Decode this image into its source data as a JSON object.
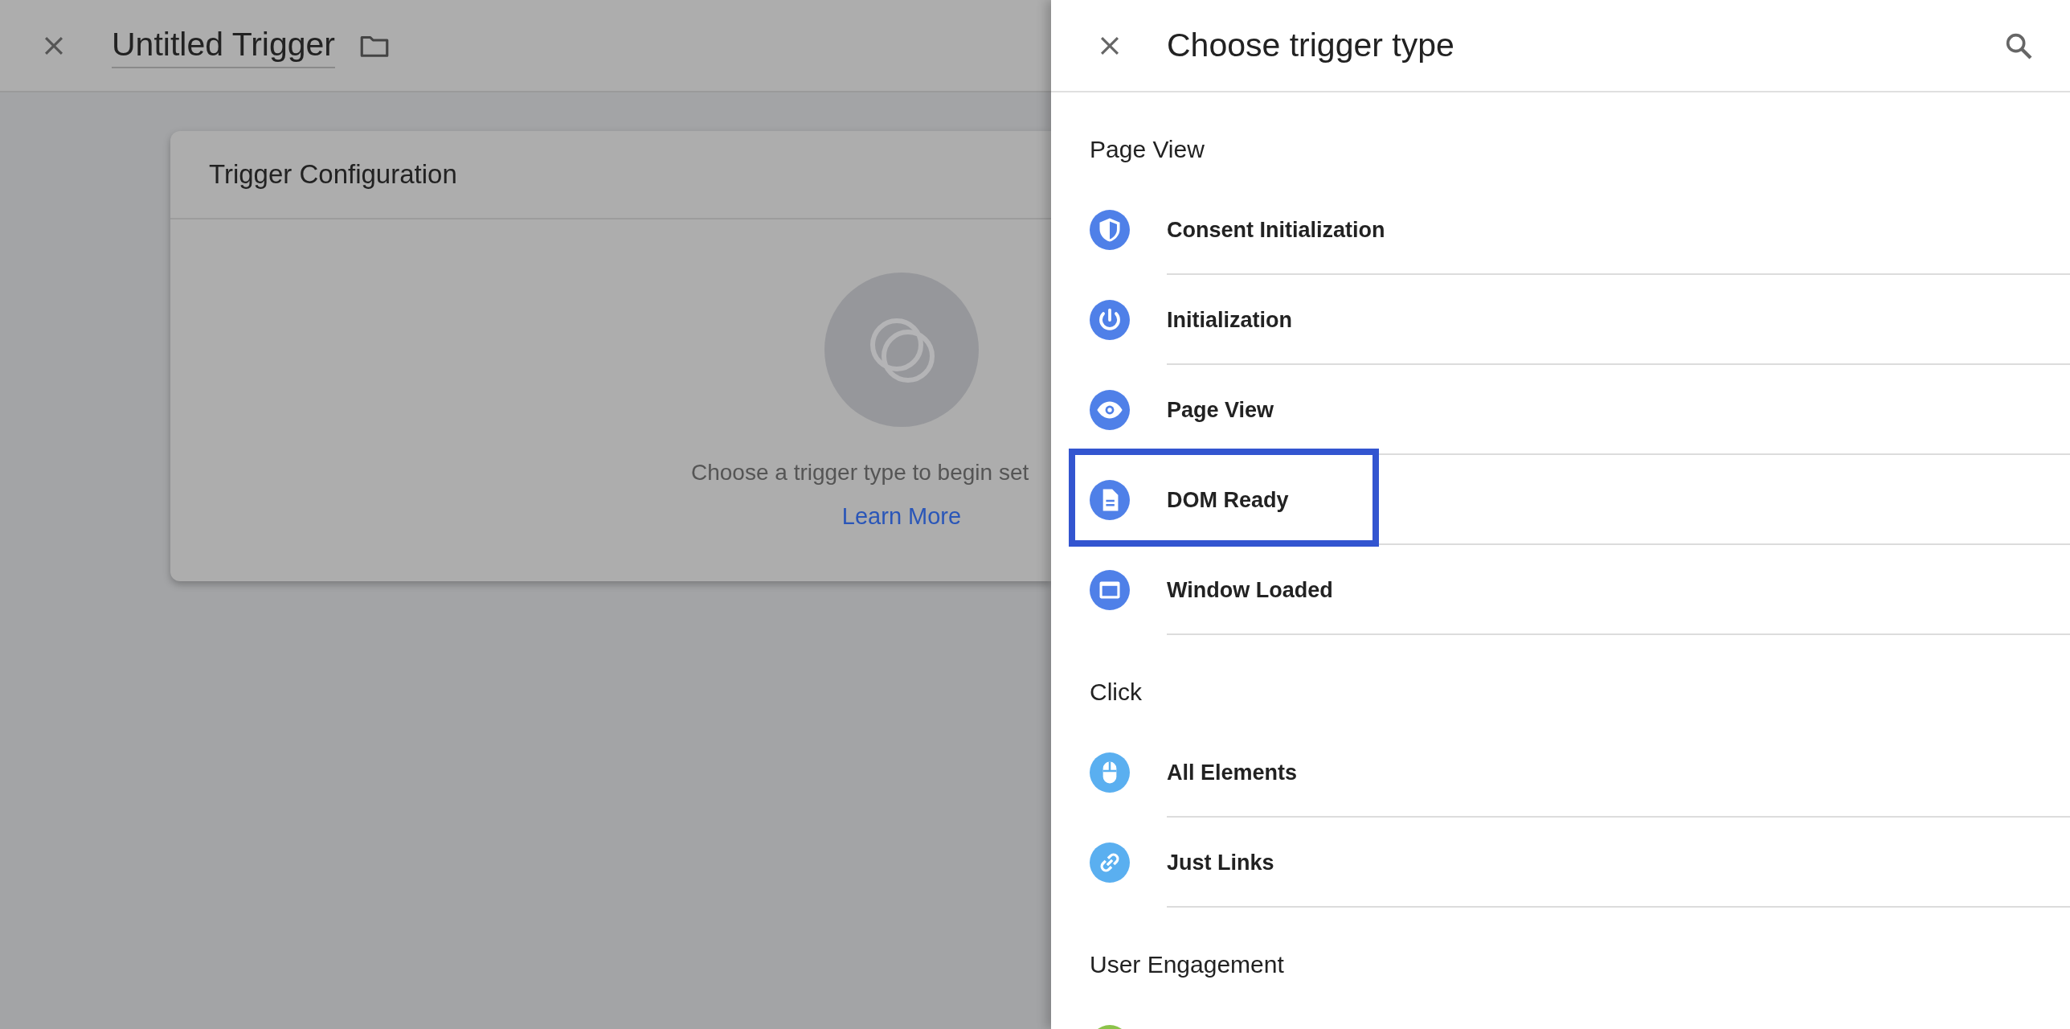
{
  "editor": {
    "title": "Untitled Trigger",
    "card": {
      "heading": "Trigger Configuration",
      "hint": "Choose a trigger type to begin set",
      "link": "Learn More"
    }
  },
  "panel": {
    "title": "Choose trigger type",
    "sections": [
      {
        "heading": "Page View",
        "color": "#4f80e8",
        "items": [
          {
            "label": "Consent Initialization",
            "highlighted": false
          },
          {
            "label": "Initialization",
            "highlighted": false
          },
          {
            "label": "Page View",
            "highlighted": false
          },
          {
            "label": "DOM Ready",
            "highlighted": true
          },
          {
            "label": "Window Loaded",
            "highlighted": false
          }
        ]
      },
      {
        "heading": "Click",
        "color": "#5aaff0",
        "items": [
          {
            "label": "All Elements",
            "highlighted": false
          },
          {
            "label": "Just Links",
            "highlighted": false
          }
        ]
      },
      {
        "heading": "User Engagement",
        "color": "#8bc34a",
        "items": [
          {
            "highlighted": false
          }
        ]
      }
    ]
  }
}
